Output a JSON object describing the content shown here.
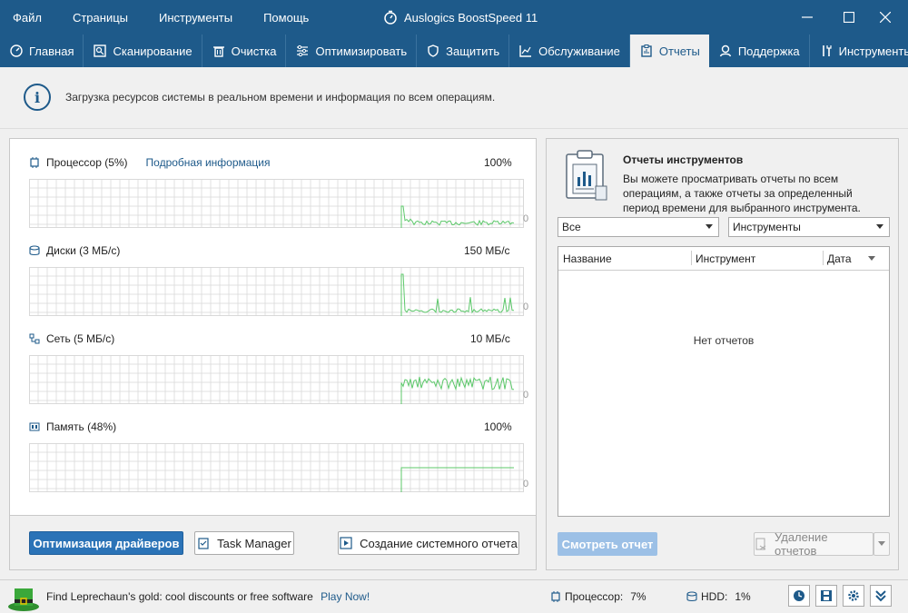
{
  "menu": [
    "Файл",
    "Страницы",
    "Инструменты",
    "Помощь"
  ],
  "app_title": "Auslogics BoostSpeed 11",
  "tabs": [
    {
      "label": "Главная",
      "icon": "dashboard-icon"
    },
    {
      "label": "Сканирование",
      "icon": "scan-icon"
    },
    {
      "label": "Очистка",
      "icon": "trash-icon"
    },
    {
      "label": "Оптимизировать",
      "icon": "sliders-icon"
    },
    {
      "label": "Защитить",
      "icon": "shield-icon"
    },
    {
      "label": "Обслуживание",
      "icon": "chart-icon"
    },
    {
      "label": "Отчеты",
      "icon": "clipboard-icon",
      "active": true
    },
    {
      "label": "Поддержка",
      "icon": "user-icon"
    },
    {
      "label": "Инструменты",
      "icon": "tools-icon"
    }
  ],
  "info_text": "Загрузка ресурсов системы в реальном времени и информация по всем операциям.",
  "graphs": [
    {
      "label": "Процессор (5%)",
      "max": "100%",
      "zero": "0",
      "icon": "cpu-icon",
      "link": "Подробная информация"
    },
    {
      "label": "Диски (3 МБ/с)",
      "max": "150 МБ/с",
      "zero": "0",
      "icon": "disk-icon"
    },
    {
      "label": "Сеть (5 МБ/с)",
      "max": "10 МБ/с",
      "zero": "0",
      "icon": "network-icon"
    },
    {
      "label": "Память (48%)",
      "max": "100%",
      "zero": "0",
      "icon": "memory-icon"
    }
  ],
  "buttons": {
    "drivers": "Оптимизация драйверов",
    "task_manager": "Task Manager",
    "system_report": "Создание системного отчета"
  },
  "reports_panel": {
    "title": "Отчеты инструментов",
    "description": "Вы можете просматривать отчеты по всем операциям, а также отчеты за определенный период времени для выбранного инструмента.",
    "filter_period": "Все",
    "filter_tool": "Инструменты",
    "columns": [
      "Название",
      "Инструмент",
      "Дата"
    ],
    "empty_text": "Нет отчетов",
    "view_button": "Смотреть отчет",
    "delete_button": "Удаление отчетов"
  },
  "status": {
    "promo": "Find Leprechaun's gold: cool discounts or free software",
    "promo_link": "Play Now!",
    "cpu": "Процессор:",
    "cpu_value": "7%",
    "hdd": "HDD:",
    "hdd_value": "1%"
  },
  "colors": {
    "titlebar": "#1e5a8a",
    "primary_button": "#2b73b7",
    "graph_line": "#5cc86a",
    "grid": "#d9d9d9"
  }
}
